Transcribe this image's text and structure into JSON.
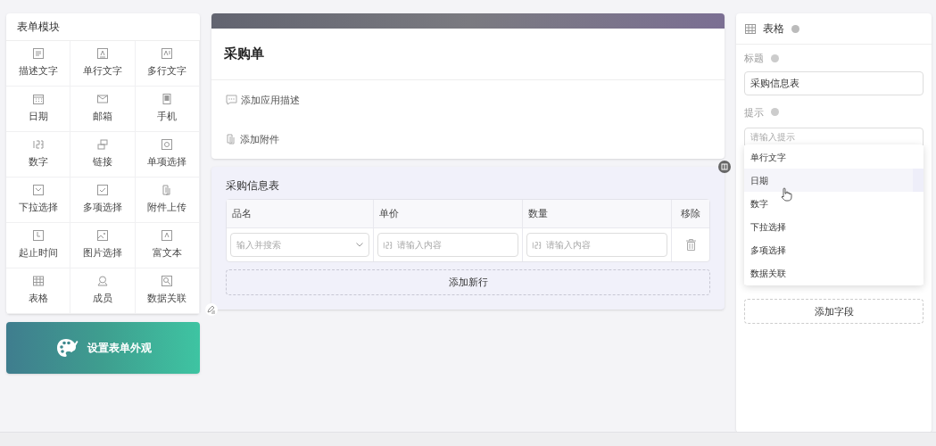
{
  "modules": {
    "title": "表单模块",
    "items": [
      {
        "label": "描述文字"
      },
      {
        "label": "单行文字"
      },
      {
        "label": "多行文字"
      },
      {
        "label": "日期"
      },
      {
        "label": "邮箱"
      },
      {
        "label": "手机"
      },
      {
        "label": "数字"
      },
      {
        "label": "链接"
      },
      {
        "label": "单项选择"
      },
      {
        "label": "下拉选择"
      },
      {
        "label": "多项选择"
      },
      {
        "label": "附件上传"
      },
      {
        "label": "起止时间"
      },
      {
        "label": "图片选择"
      },
      {
        "label": "富文本"
      },
      {
        "label": "表格"
      },
      {
        "label": "成员"
      },
      {
        "label": "数据关联"
      }
    ],
    "appearance_button": "设置表单外观"
  },
  "form": {
    "title": "采购单",
    "add_description": "添加应用描述",
    "add_attachment": "添加附件",
    "table": {
      "title": "采购信息表",
      "columns": [
        "品名",
        "单价",
        "数量",
        "移除"
      ],
      "row": [
        {
          "kind": "select",
          "placeholder": "输入并搜索"
        },
        {
          "kind": "number",
          "placeholder": "请输入内容"
        },
        {
          "kind": "number",
          "placeholder": "请输入内容"
        },
        {
          "kind": "delete"
        }
      ],
      "add_row": "添加新行"
    }
  },
  "properties": {
    "title": "表格",
    "title_label": "标题",
    "title_value": "采购信息表",
    "hint_label": "提示",
    "hint_placeholder": "请输入提示",
    "dropdown": [
      {
        "label": "单行文字",
        "selected": false
      },
      {
        "label": "日期",
        "selected": true
      },
      {
        "label": "数字",
        "selected": false
      },
      {
        "label": "下拉选择",
        "selected": false
      },
      {
        "label": "多项选择",
        "selected": false
      },
      {
        "label": "数据关联",
        "selected": false
      }
    ],
    "add_field": "添加字段"
  }
}
